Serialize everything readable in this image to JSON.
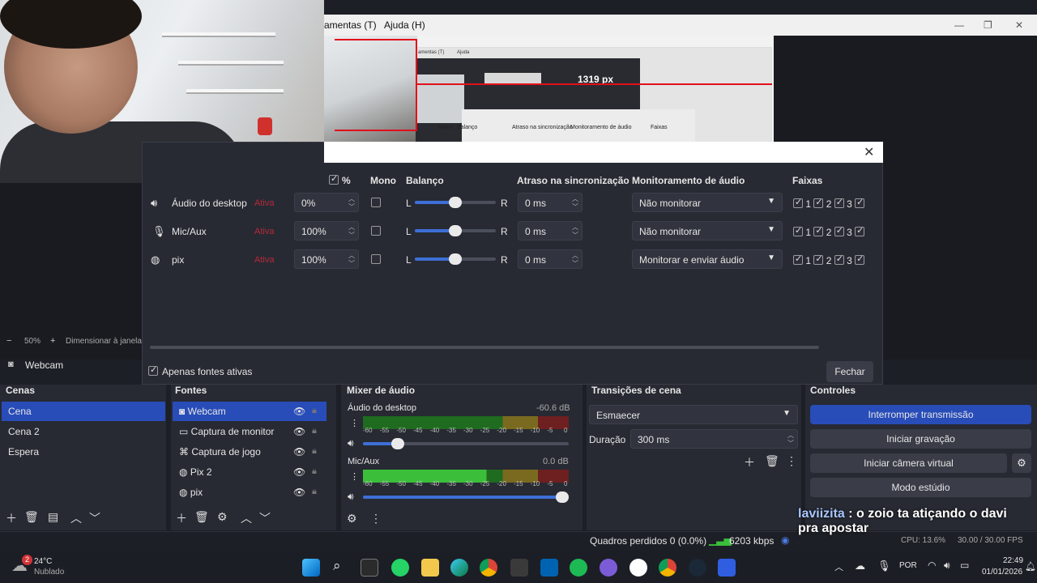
{
  "menu": {
    "tools": "amentas (T)",
    "help": "Ajuda (H)"
  },
  "preview": {
    "measurement": "1319 px",
    "zoom": "50%",
    "resize": "Dimensionar à janela",
    "source_label": "Webcam"
  },
  "nested": {
    "menu": "amentas (T)",
    "help": "Ajuda",
    "headers": [
      "Mono",
      "Balanço",
      "Atraso na sincronização",
      "Monitoramento de áudio",
      "Faixas"
    ]
  },
  "dialog": {
    "headers": {
      "pct": "%",
      "mono": "Mono",
      "balance": "Balanço",
      "delay": "Atraso na sincronização",
      "monitor": "Monitoramento de áudio",
      "tracks": "Faixas"
    },
    "rows": [
      {
        "name": "Áudio do desktop",
        "status": "Ativa",
        "volume": "0%",
        "delay": "0 ms",
        "monitor": "Não monitorar",
        "icon": "speaker-icon"
      },
      {
        "name": "Mic/Aux",
        "status": "Ativa",
        "volume": "100%",
        "delay": "0 ms",
        "monitor": "Não monitorar",
        "icon": "microphone-icon"
      },
      {
        "name": "pix",
        "status": "Ativa",
        "volume": "100%",
        "delay": "0 ms",
        "monitor": "Monitorar e enviar áudio",
        "icon": "globe-icon"
      }
    ],
    "balance_L": "L",
    "balance_R": "R",
    "track_labels": [
      "1",
      "2",
      "3"
    ],
    "active_only": "Apenas fontes ativas",
    "close": "Fechar"
  },
  "docks": {
    "scenes": {
      "title": "Cenas",
      "items": [
        "Cena",
        "Cena 2",
        "Espera"
      ]
    },
    "sources": {
      "title": "Fontes",
      "items": [
        "Webcam",
        "Captura de monitor",
        "Captura de jogo",
        "Pix 2",
        "pix"
      ]
    },
    "mixer": {
      "title": "Mixer de áudio",
      "ch1": {
        "name": "Áudio do desktop",
        "db": "-60.6 dB"
      },
      "ch2": {
        "name": "Mic/Aux",
        "db": "0.0 dB"
      },
      "scale": [
        "-60",
        "-55",
        "-50",
        "-45",
        "-40",
        "-35",
        "-30",
        "-25",
        "-20",
        "-15",
        "-10",
        "-5",
        "0"
      ]
    },
    "transitions": {
      "title": "Transições de cena",
      "type": "Esmaecer",
      "duration_label": "Duração",
      "duration": "300 ms"
    },
    "controls": {
      "title": "Controles",
      "buttons": [
        "Interromper transmissão",
        "Iniciar gravação",
        "Iniciar câmera virtual",
        "Modo estúdio"
      ]
    }
  },
  "status": {
    "dropped": "Quadros perdidos 0 (0.0%)",
    "kbps": "6203 kbps",
    "cpu": "CPU: 13.6%",
    "fps": "30.00 / 30.00 FPS"
  },
  "chat": {
    "user": "laviizita",
    "text": ": o zoio ta atiçando o davi pra apostar"
  },
  "taskbar": {
    "temp": "24°C",
    "weather": "Nublado",
    "badge": "2",
    "lang": "POR",
    "time": "22:49",
    "date": "01/01/2026"
  },
  "colors": {
    "accent": "#284cb8",
    "active_red": "#b8283a",
    "meter_green": "#3bbf3b",
    "red_guide": "#e3101a"
  }
}
